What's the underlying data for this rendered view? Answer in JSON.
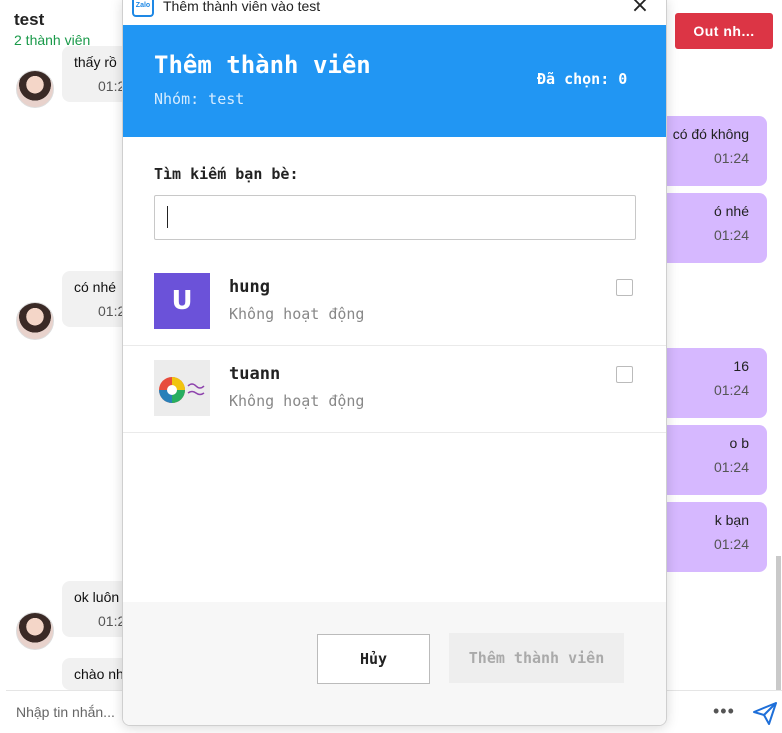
{
  "chat": {
    "title": "test",
    "members": "2 thành viên",
    "out_button": "Out nh...",
    "incoming": [
      {
        "text": "thấy rồ",
        "time": "01:2"
      },
      {
        "text": "có nhé",
        "time": "01:2"
      },
      {
        "text": "ok luôn",
        "time": "01:2"
      },
      {
        "text": "chào nh",
        "time": ""
      }
    ],
    "outgoing": [
      {
        "text": "có đó không",
        "time": "01:24"
      },
      {
        "text": "ó nhé",
        "time": "01:24"
      },
      {
        "text": "16",
        "time": "01:24"
      },
      {
        "text": "o b",
        "time": "01:24"
      },
      {
        "text": "k bạn",
        "time": "01:24"
      }
    ],
    "input_placeholder": "Nhập tin nhắn..."
  },
  "modal": {
    "window_title": "Thêm thành viên vào test",
    "app_icon_label": "Zalo",
    "title": "Thêm thành viên",
    "group_label": "Nhóm: test",
    "selected_label": "Đã chọn: 0",
    "search_label": "Tìm kiếm bạn bè:",
    "search_value": "",
    "friends": [
      {
        "name": "hung",
        "status": "Không hoạt động",
        "initial": "U",
        "checked": false
      },
      {
        "name": "tuann",
        "status": "Không hoạt động",
        "initial": "",
        "checked": false
      }
    ],
    "cancel_button": "Hủy",
    "add_button": "Thêm thành viên"
  },
  "colors": {
    "header_blue": "#2196f3",
    "out_button_red": "#dc3545",
    "outgoing_bubble": "#d6b8ff",
    "avatar_purple": "#6b52d9"
  }
}
